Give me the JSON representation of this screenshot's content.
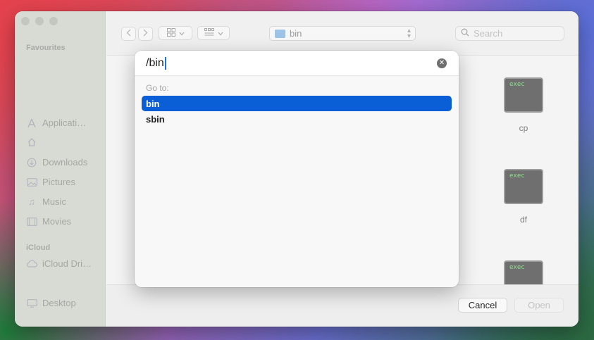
{
  "window": {
    "sidebar": {
      "sections": [
        {
          "heading": "Favourites",
          "items": [
            {
              "label": "Applicati…",
              "icon": "applications-icon"
            },
            {
              "label": "",
              "icon": "home-icon"
            },
            {
              "label": "Downloads",
              "icon": "downloads-icon"
            },
            {
              "label": "Pictures",
              "icon": "pictures-icon"
            },
            {
              "label": "Music",
              "icon": "music-icon"
            },
            {
              "label": "Movies",
              "icon": "movies-icon"
            }
          ]
        },
        {
          "heading": "iCloud",
          "items": [
            {
              "label": "iCloud Dri…",
              "icon": "cloud-icon"
            },
            {
              "label": "Desktop",
              "icon": "desktop-icon"
            }
          ]
        }
      ]
    },
    "toolbar": {
      "location": "bin",
      "search_placeholder": "Search"
    },
    "files": [
      {
        "name": "cp",
        "badge": "exec"
      },
      {
        "name": "df",
        "badge": "exec"
      },
      {
        "name": "",
        "badge": "exec"
      }
    ],
    "footer": {
      "cancel_label": "Cancel",
      "open_label": "Open"
    }
  },
  "goto_sheet": {
    "path_value": "/bin",
    "label": "Go to:",
    "suggestions": [
      {
        "label": "bin",
        "selected": true
      },
      {
        "label": "sbin",
        "selected": false
      }
    ]
  },
  "colors": {
    "selection": "#0a5fd6",
    "caret": "#1a73e8"
  }
}
